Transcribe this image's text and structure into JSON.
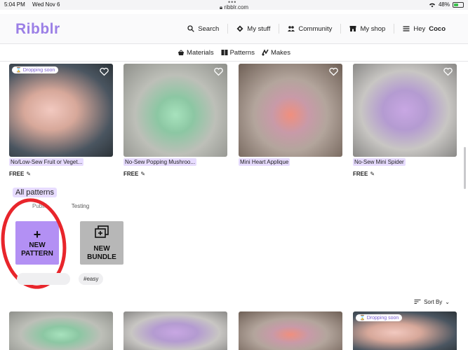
{
  "status": {
    "time": "5:04 PM",
    "date": "Wed Nov 6",
    "url": "ribblr.com",
    "battery": "48%",
    "battery_level": 0.48
  },
  "header": {
    "logo": "Ribblr",
    "nav": [
      {
        "label": "Search",
        "icon": "search-icon"
      },
      {
        "label": "My stuff",
        "icon": "diamond-icon"
      },
      {
        "label": "Community",
        "icon": "community-icon"
      },
      {
        "label": "My shop",
        "icon": "shop-icon"
      }
    ],
    "greeting": "Hey",
    "user": "Coco"
  },
  "subnav": [
    {
      "label": "Materials",
      "icon": "basket-icon"
    },
    {
      "label": "Patterns",
      "icon": "book-icon"
    },
    {
      "label": "Makes",
      "icon": "yarn-icon"
    }
  ],
  "cards": [
    {
      "title": "No/Low-Sew Fruit or Veget...",
      "price": "FREE",
      "badge": "Dropping soon"
    },
    {
      "title": "No-Sew Popping Mushroo...",
      "price": "FREE"
    },
    {
      "title": "Mini Heart Applique",
      "price": ""
    },
    {
      "title": "No-Sew Mini Spider",
      "price": "FREE"
    }
  ],
  "section": {
    "label": "All patterns",
    "tabs": [
      "Public",
      "Testing"
    ],
    "new_pattern": {
      "symbol": "+",
      "line1": "NEW",
      "line2": "PATTERN"
    },
    "new_bundle": {
      "line1": "NEW",
      "line2": "BUNDLE"
    },
    "chips": [
      "",
      "#easy"
    ],
    "sort_label": "Sort By"
  },
  "bottom_cards": [
    {
      "badge": ""
    },
    {
      "badge": ""
    },
    {
      "badge": ""
    },
    {
      "badge": "Dropping soon"
    }
  ],
  "colors": {
    "brand": "#9b7fe6",
    "highlight": "#e7dcff",
    "new_pattern_bg": "#b390f4",
    "annotation_red": "#e8252b"
  }
}
